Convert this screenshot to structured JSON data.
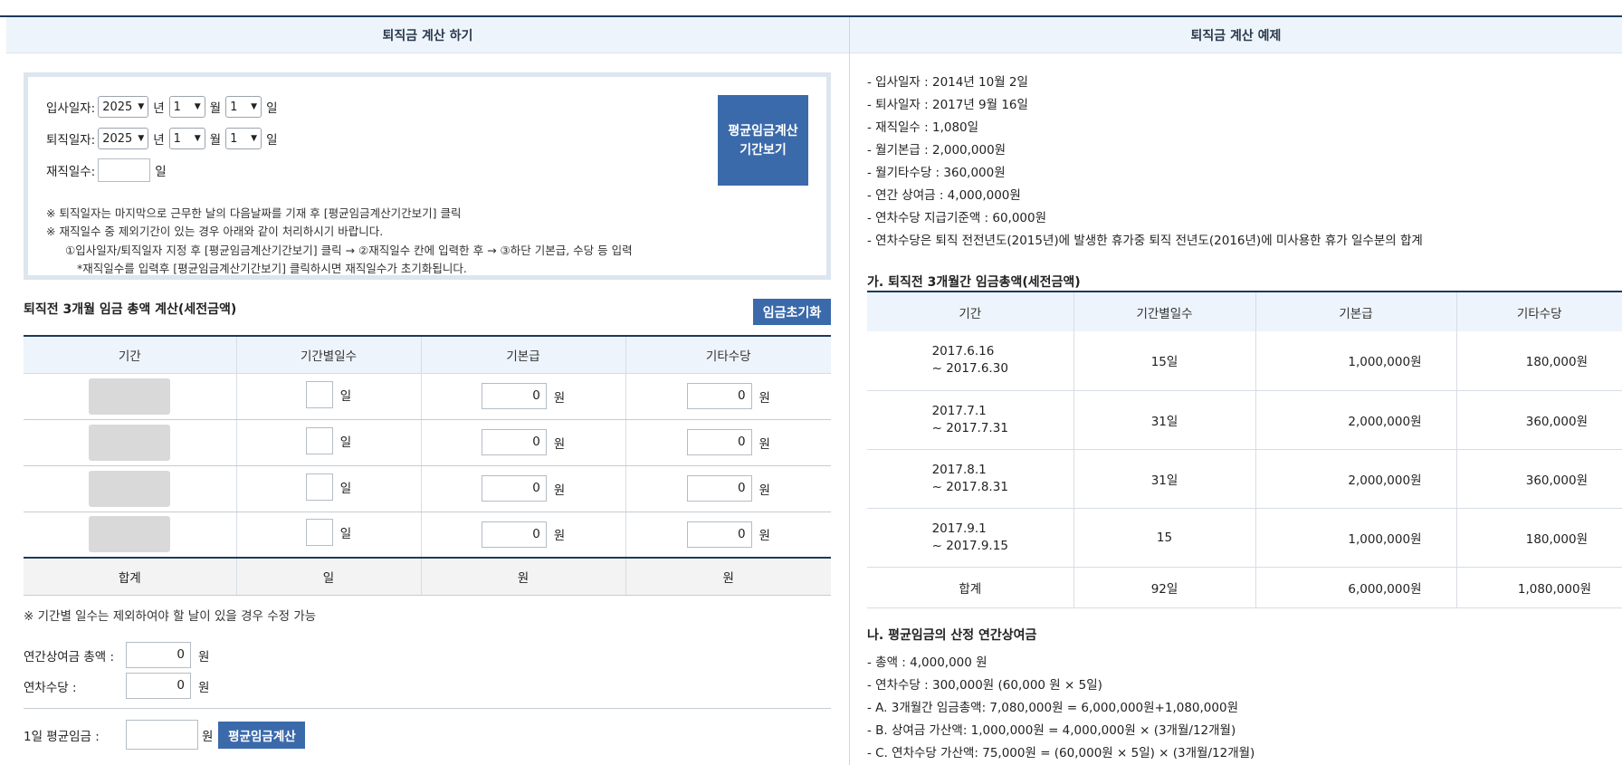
{
  "left_header": "퇴직금 계산 하기",
  "right_header": "퇴직금 계산 예제",
  "date_form": {
    "join_label": "입사일자:",
    "leave_label": "퇴직일자:",
    "days_label": "재직일수:",
    "year_unit": "년",
    "month_unit": "월",
    "day_unit": "일",
    "join": {
      "year": "2025",
      "month": "1",
      "day": "1"
    },
    "leave": {
      "year": "2025",
      "month": "1",
      "day": "1"
    },
    "days_value": "",
    "period_button": [
      "평균임금계산",
      "기간보기"
    ],
    "notes": [
      "※ 퇴직일자는 마지막으로 근무한 날의 다음날짜를 기재 후 [평균임금계산기간보기] 클릭",
      "※ 재직일수 중 제외기간이 있는 경우 아래와 같이 처리하시기 바랍니다.",
      "①입사일자/퇴직일자 지정 후 [평균임금계산기간보기] 클릭 → ②재직일수 칸에 입력한 후 → ③하단 기본급, 수당 등 입력",
      "*재직일수를 입력후 [평균임금계산기간보기] 클릭하시면 재직일수가 초기화됩니다."
    ]
  },
  "wage_section": {
    "title": "퇴직전 3개월 임금 총액 계산(세전금액)",
    "reset_button": "임금초기화",
    "headers": [
      "기간",
      "기간별일수",
      "기본급",
      "기타수당"
    ],
    "rows": [
      {
        "base": "0",
        "other": "0"
      },
      {
        "base": "0",
        "other": "0"
      },
      {
        "base": "0",
        "other": "0"
      },
      {
        "base": "0",
        "other": "0"
      }
    ],
    "day_unit": "일",
    "won_unit": "원",
    "sum_label": "합계",
    "sum_days_unit": "일",
    "sum_base_unit": "원",
    "sum_other_unit": "원",
    "note": "※ 기간별 일수는 제외하여야 할 날이 있을 경우 수정 가능",
    "bonus_label": "연간상여금 총액 :",
    "bonus_value": "0",
    "leave_pay_label": "연차수당 :",
    "leave_pay_value": "0",
    "avg_label": "1일 평균임금 :",
    "avg_value": "",
    "avg_button": "평균임금계산"
  },
  "example": {
    "items": [
      "- 입사일자 : 2014년 10월 2일",
      "- 퇴사일자 : 2017년 9월 16일",
      "- 재직일수 : 1,080일",
      "- 월기본급 : 2,000,000원",
      "- 월기타수당 : 360,000원",
      "- 연간 상여금 : 4,000,000원",
      "- 연차수당 지급기준액 : 60,000원",
      "- 연차수당은 퇴직 전전년도(2015년)에 발생한 휴가중 퇴직 전년도(2016년)에 미사용한 휴가 일수분의 합계"
    ],
    "table_title": "가. 퇴직전 3개월간 임금총액(세전금액)",
    "headers": [
      "기간",
      "기간별일수",
      "기본급",
      "기타수당"
    ],
    "rows": [
      {
        "p1": "2017.6.16",
        "p2": "~ 2017.6.30",
        "days": "15일",
        "base": "1,000,000원",
        "other": "180,000원"
      },
      {
        "p1": "2017.7.1",
        "p2": "~ 2017.7.31",
        "days": "31일",
        "base": "2,000,000원",
        "other": "360,000원"
      },
      {
        "p1": "2017.8.1",
        "p2": "~ 2017.8.31",
        "days": "31일",
        "base": "2,000,000원",
        "other": "360,000원"
      },
      {
        "p1": "2017.9.1",
        "p2": "~ 2017.9.15",
        "days": "15",
        "base": "1,000,000원",
        "other": "180,000원"
      }
    ],
    "sum": {
      "label": "합계",
      "days": "92일",
      "base": "6,000,000원",
      "other": "1,080,000원"
    },
    "avg_title": "나. 평균임금의 산정 연간상여금",
    "avg_items": [
      "- 총액 : 4,000,000 원",
      "- 연차수당 : 300,000원 (60,000 원 × 5일)",
      "- A. 3개월간 임금총액: 7,080,000원 = 6,000,000원+1,080,000원",
      "- B. 상여금 가산액: 1,000,000원 = 4,000,000원 × (3개월/12개월)",
      "- C. 연차수당 가산액: 75,000원 = (60,000원 × 5일) × (3개월/12개월)"
    ]
  }
}
